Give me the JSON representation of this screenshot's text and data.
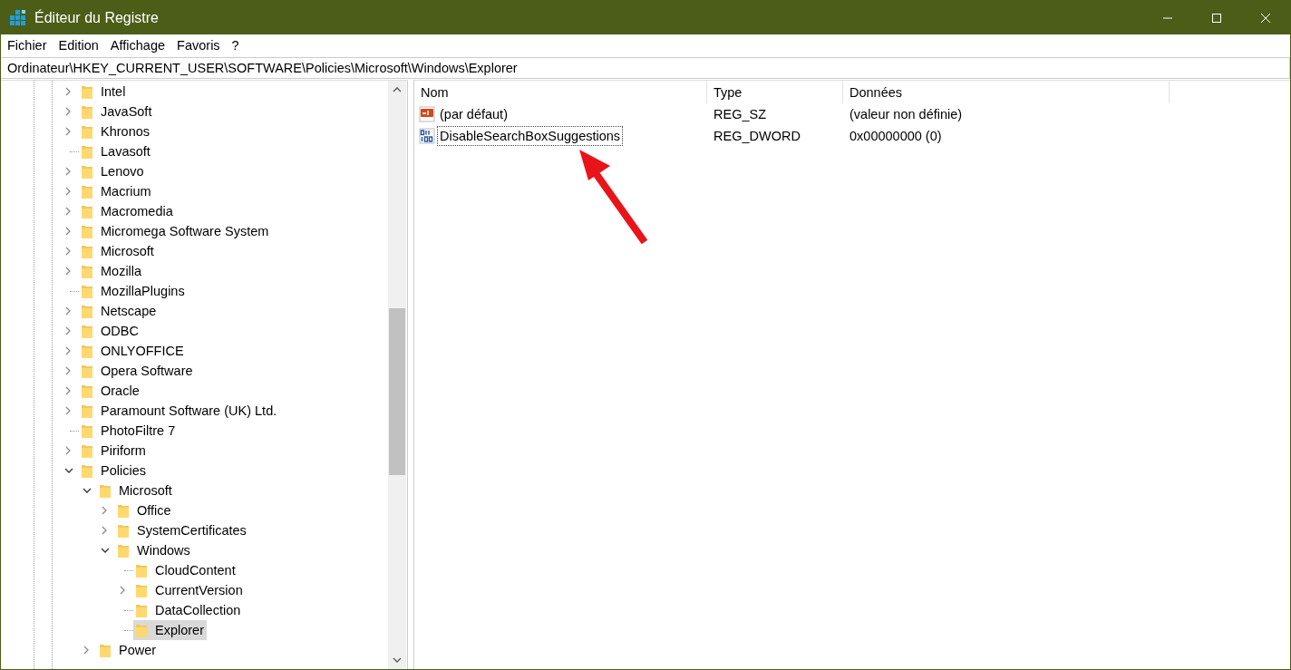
{
  "window": {
    "title": "Éditeur du Registre"
  },
  "menu": [
    "Fichier",
    "Edition",
    "Affichage",
    "Favoris",
    "?"
  ],
  "address": "Ordinateur\\HKEY_CURRENT_USER\\SOFTWARE\\Policies\\Microsoft\\Windows\\Explorer",
  "tree": [
    {
      "label": "Intel",
      "expanded": false,
      "has_children": true,
      "selected": false
    },
    {
      "label": "JavaSoft",
      "expanded": false,
      "has_children": true,
      "selected": false
    },
    {
      "label": "Khronos",
      "expanded": false,
      "has_children": true,
      "selected": false
    },
    {
      "label": "Lavasoft",
      "has_children": false,
      "selected": false
    },
    {
      "label": "Lenovo",
      "expanded": false,
      "has_children": true,
      "selected": false
    },
    {
      "label": "Macrium",
      "expanded": false,
      "has_children": true,
      "selected": false
    },
    {
      "label": "Macromedia",
      "expanded": false,
      "has_children": true,
      "selected": false
    },
    {
      "label": "Micromega Software System",
      "expanded": false,
      "has_children": true,
      "selected": false
    },
    {
      "label": "Microsoft",
      "expanded": false,
      "has_children": true,
      "selected": false
    },
    {
      "label": "Mozilla",
      "expanded": false,
      "has_children": true,
      "selected": false
    },
    {
      "label": "MozillaPlugins",
      "has_children": false,
      "selected": false
    },
    {
      "label": "Netscape",
      "expanded": false,
      "has_children": true,
      "selected": false
    },
    {
      "label": "ODBC",
      "expanded": false,
      "has_children": true,
      "selected": false
    },
    {
      "label": "ONLYOFFICE",
      "expanded": false,
      "has_children": true,
      "selected": false
    },
    {
      "label": "Opera Software",
      "expanded": false,
      "has_children": true,
      "selected": false
    },
    {
      "label": "Oracle",
      "expanded": false,
      "has_children": true,
      "selected": false
    },
    {
      "label": "Paramount Software (UK) Ltd.",
      "expanded": false,
      "has_children": true,
      "selected": false
    },
    {
      "label": "PhotoFiltre 7",
      "has_children": false,
      "selected": false
    },
    {
      "label": "Piriform",
      "expanded": false,
      "has_children": true,
      "selected": false
    },
    {
      "label": "Policies",
      "expanded": true,
      "has_children": true,
      "selected": false,
      "children": [
        {
          "label": "Microsoft",
          "expanded": true,
          "has_children": true,
          "selected": false,
          "children": [
            {
              "label": "Office",
              "expanded": false,
              "has_children": true,
              "selected": false
            },
            {
              "label": "SystemCertificates",
              "expanded": false,
              "has_children": true,
              "selected": false
            },
            {
              "label": "Windows",
              "expanded": true,
              "has_children": true,
              "selected": false,
              "children": [
                {
                  "label": "CloudContent",
                  "has_children": false,
                  "selected": false
                },
                {
                  "label": "CurrentVersion",
                  "expanded": false,
                  "has_children": true,
                  "selected": false
                },
                {
                  "label": "DataCollection",
                  "has_children": false,
                  "selected": false
                },
                {
                  "label": "Explorer",
                  "has_children": false,
                  "selected": true
                }
              ]
            }
          ]
        },
        {
          "label": "Power",
          "expanded": false,
          "has_children": true,
          "selected": false
        }
      ]
    }
  ],
  "columns": [
    "Nom",
    "Type",
    "Données"
  ],
  "values": [
    {
      "kind": "string",
      "name": "(par défaut)",
      "type": "REG_SZ",
      "data": "(valeur non définie)",
      "focused": false
    },
    {
      "kind": "dword",
      "name": "DisableSearchBoxSuggestions",
      "type": "REG_DWORD",
      "data": "0x00000000 (0)",
      "focused": true
    }
  ]
}
